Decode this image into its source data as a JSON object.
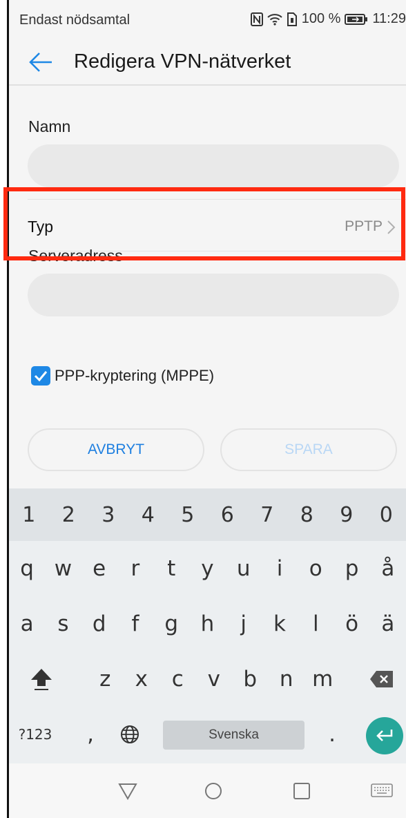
{
  "status_bar": {
    "left_text": "Endast nödsamtal",
    "battery": "100 %",
    "time": "11:29",
    "icons": [
      "nfc-icon",
      "wifi-icon",
      "sim-icon",
      "battery-icon"
    ]
  },
  "app_bar": {
    "title": "Redigera VPN-nätverket",
    "back_icon": "back-arrow-icon",
    "accent": "#1e88e5"
  },
  "form": {
    "name_label": "Namn",
    "name_value": "",
    "type_label": "Typ",
    "type_value": "PPTP",
    "server_label": "Serveradress",
    "server_value": "",
    "encryption_label": "PPP-kryptering (MPPE)",
    "encryption_checked": true
  },
  "buttons": {
    "cancel_label": "AVBRYT",
    "save_label": "SPARA",
    "save_enabled": false
  },
  "highlight_color": "#ff2a10",
  "keyboard": {
    "number_row": [
      "1",
      "2",
      "3",
      "4",
      "5",
      "6",
      "7",
      "8",
      "9",
      "0"
    ],
    "row1": [
      "q",
      "w",
      "e",
      "r",
      "t",
      "y",
      "u",
      "i",
      "o",
      "p",
      "å"
    ],
    "row2": [
      "a",
      "s",
      "d",
      "f",
      "g",
      "h",
      "j",
      "k",
      "l",
      "ö",
      "ä"
    ],
    "row3": [
      "z",
      "x",
      "c",
      "v",
      "b",
      "n",
      "m"
    ],
    "symbols_label": "?123",
    "comma_label": ",",
    "space_label": "Svenska",
    "period_label": ".",
    "icons": [
      "shift-icon",
      "backspace-icon",
      "globe-icon",
      "enter-icon"
    ],
    "enter_color": "#26a69a"
  },
  "nav_bar": {
    "icons": [
      "back-triangle-icon",
      "home-circle-icon",
      "recents-square-icon",
      "keyboard-toggle-icon"
    ]
  }
}
